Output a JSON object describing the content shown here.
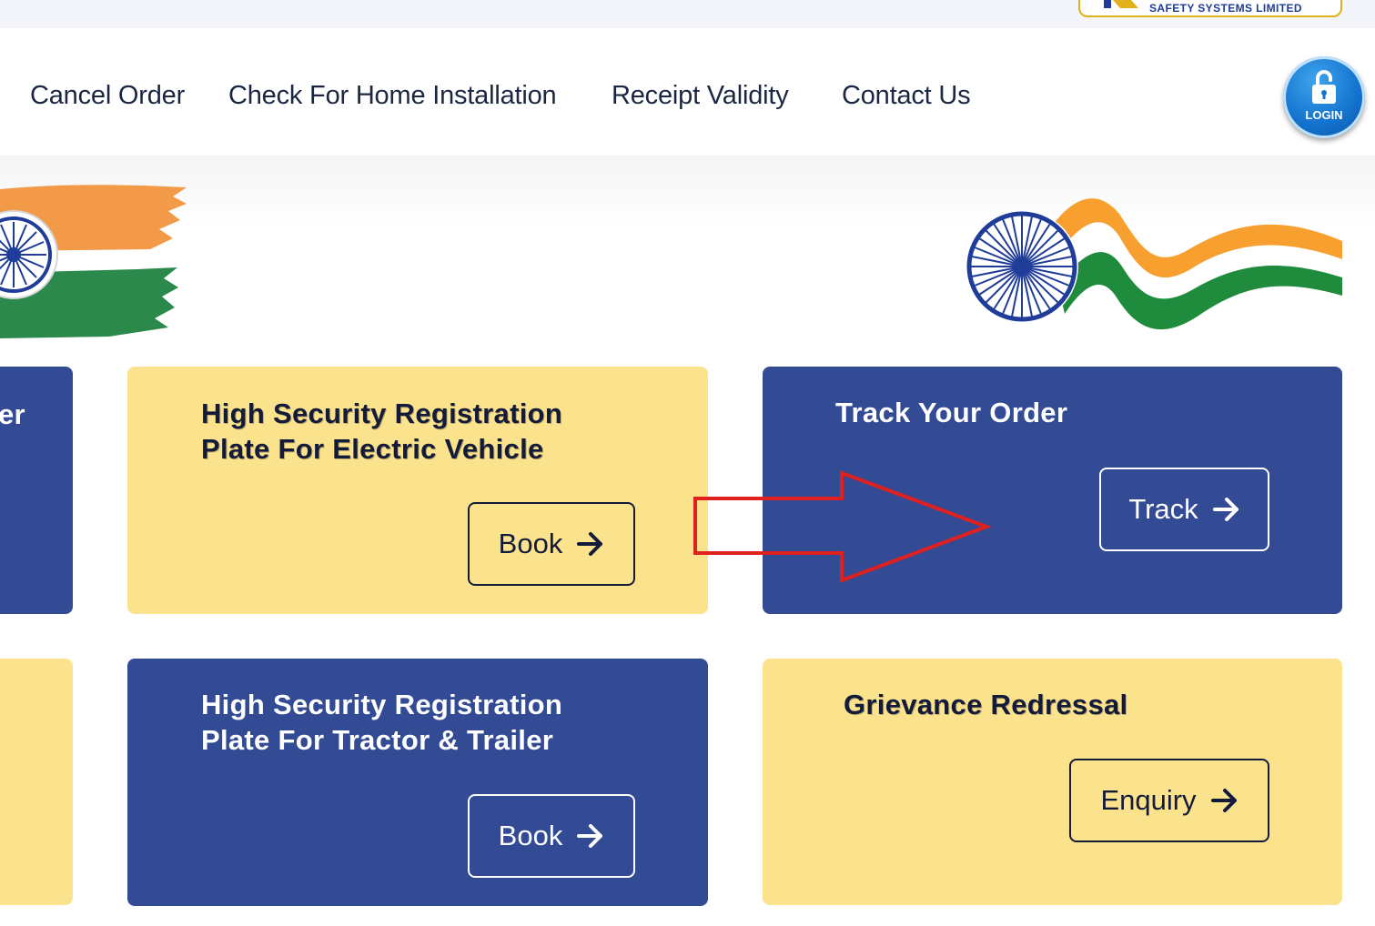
{
  "header": {
    "logo_text": "SAFETY SYSTEMS LIMITED"
  },
  "nav": {
    "items": [
      {
        "label": "Cancel Order"
      },
      {
        "label": "Check For Home Installation"
      },
      {
        "label": "Receipt Validity"
      },
      {
        "label": "Contact Us"
      }
    ],
    "login_label": "LOGIN"
  },
  "cards": {
    "left_top_partial_title": "er",
    "ev_title_line1": "High Security Registration",
    "ev_title_line2": "Plate For Electric Vehicle",
    "ev_button": "Book",
    "track_title": "Track Your Order",
    "track_button": "Track",
    "tractor_title_line1": "High Security Registration",
    "tractor_title_line2": "Plate For Tractor & Trailer",
    "tractor_button": "Book",
    "grievance_title": "Grievance Redressal",
    "grievance_button": "Enquiry"
  },
  "colors": {
    "card_yellow": "#fbe38e",
    "card_blue": "#324b94",
    "annotation_red": "#e0201f",
    "nav_text": "#1b2742"
  },
  "icons": {
    "button_arrow": "arrow-right-icon",
    "login": "unlock-icon"
  }
}
